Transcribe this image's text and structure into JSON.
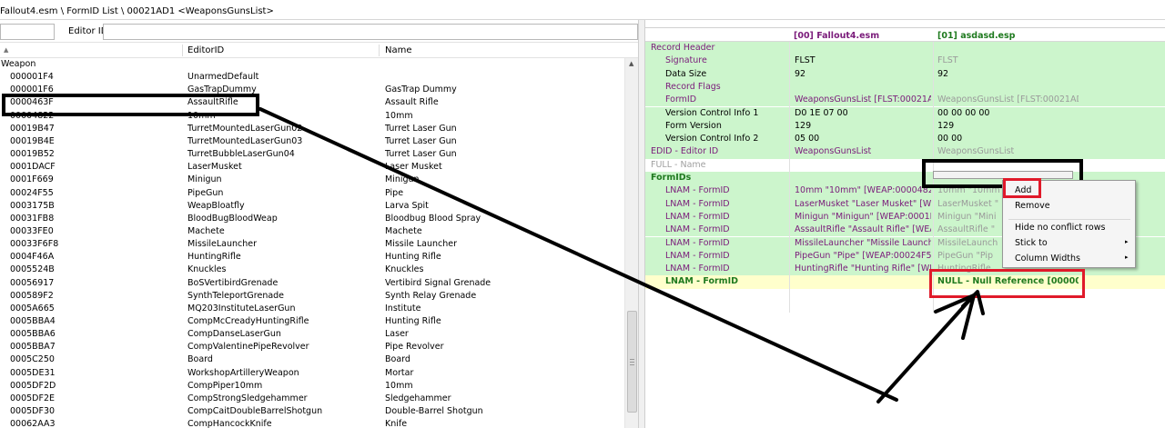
{
  "breadcrumb": "Fallout4.esm \\ FormID List \\ 00021AD1 <WeaponsGunsList>",
  "left": {
    "filter_label": "Editor ID",
    "columns": [
      "EditorID",
      "Name"
    ],
    "group": "Weapon",
    "rows": [
      {
        "formid": "000001F4",
        "editorid": "UnarmedDefault",
        "name": ""
      },
      {
        "formid": "000001F6",
        "editorid": "GasTrapDummy",
        "name": "GasTrap Dummy"
      },
      {
        "formid": "0000463F",
        "editorid": "AssaultRifle",
        "name": "Assault Rifle"
      },
      {
        "formid": "00004822",
        "editorid": "10mm",
        "name": "10mm"
      },
      {
        "formid": "00019B47",
        "editorid": "TurretMountedLaserGun02",
        "name": "Turret Laser Gun"
      },
      {
        "formid": "00019B4E",
        "editorid": "TurretMountedLaserGun03",
        "name": "Turret Laser Gun"
      },
      {
        "formid": "00019B52",
        "editorid": "TurretBubbleLaserGun04",
        "name": "Turret Laser Gun"
      },
      {
        "formid": "0001DACF",
        "editorid": "LaserMusket",
        "name": "Laser Musket"
      },
      {
        "formid": "0001F669",
        "editorid": "Minigun",
        "name": "Minigun"
      },
      {
        "formid": "00024F55",
        "editorid": "PipeGun",
        "name": "Pipe"
      },
      {
        "formid": "0003175B",
        "editorid": "WeapBloatfly",
        "name": "Larva Spit"
      },
      {
        "formid": "00031FB8",
        "editorid": "BloodBugBloodWeap",
        "name": "Bloodbug Blood Spray"
      },
      {
        "formid": "00033FE0",
        "editorid": "Machete",
        "name": "Machete"
      },
      {
        "formid": "00033F6F8",
        "editorid": "MissileLauncher",
        "name": "Missile Launcher"
      },
      {
        "formid": "0004F46A",
        "editorid": "HuntingRifle",
        "name": "Hunting Rifle"
      },
      {
        "formid": "0005524B",
        "editorid": "Knuckles",
        "name": "Knuckles"
      },
      {
        "formid": "00056917",
        "editorid": "BoSVertibirdGrenade",
        "name": "Vertibird Signal Grenade"
      },
      {
        "formid": "000589F2",
        "editorid": "SynthTeleportGrenade",
        "name": "Synth Relay Grenade"
      },
      {
        "formid": "0005A665",
        "editorid": "MQ203InstituteLaserGun",
        "name": "Institute"
      },
      {
        "formid": "0005BBA4",
        "editorid": "CompMcCreadyHuntingRifle",
        "name": "Hunting Rifle"
      },
      {
        "formid": "0005BBA6",
        "editorid": "CompDanseLaserGun",
        "name": "Laser"
      },
      {
        "formid": "0005BBA7",
        "editorid": "CompValentinePipeRevolver",
        "name": "Pipe Revolver"
      },
      {
        "formid": "0005C250",
        "editorid": "Board",
        "name": "Board"
      },
      {
        "formid": "0005DE31",
        "editorid": "WorkshopArtilleryWeapon",
        "name": "Mortar"
      },
      {
        "formid": "0005DF2D",
        "editorid": "CompPiper10mm",
        "name": "10mm"
      },
      {
        "formid": "0005DF2E",
        "editorid": "CompStrongSledgehammer",
        "name": "Sledgehammer"
      },
      {
        "formid": "0005DF30",
        "editorid": "CompCaitDoubleBarrelShotgun",
        "name": "Double-Barrel Shotgun"
      },
      {
        "formid": "00062AA3",
        "editorid": "CompHancockKnife",
        "name": "Knife"
      }
    ]
  },
  "right": {
    "col_master": "[00] Fallout4.esm",
    "col_plugin": "[01] asdasd.esp",
    "rows": [
      {
        "label": "Record Header",
        "indent": 0,
        "color": "#7a1b7a",
        "v1": "",
        "v2": "",
        "bg": "#ccf5cc"
      },
      {
        "label": "Signature",
        "indent": 1,
        "color": "#7a1b7a",
        "v1": "FLST",
        "v2": "FLST",
        "bg": "#ccf5cc",
        "v2grey": true
      },
      {
        "label": "Data Size",
        "indent": 1,
        "color": "#000000",
        "v1": "92",
        "v2": "92",
        "bg": "#ccf5cc"
      },
      {
        "label": "Record Flags",
        "indent": 1,
        "color": "#7a1b7a",
        "v1": "",
        "v2": "",
        "bg": "#ccf5cc"
      },
      {
        "label": "FormID",
        "indent": 1,
        "color": "#7a1b7a",
        "v1": "WeaponsGunsList [FLST:00021AD1]",
        "v2": "WeaponsGunsList [FLST:00021AD1]",
        "bg": "#ccf5cc",
        "v1purple": true,
        "v2grey": true
      },
      {
        "label": "Version Control Info 1",
        "indent": 1,
        "color": "#000000",
        "v1": "D0 1E 07 00",
        "v2": "00 00 00 00",
        "bg": "#ccf5cc"
      },
      {
        "label": "Form Version",
        "indent": 1,
        "color": "#000000",
        "v1": "129",
        "v2": "129",
        "bg": "#ccf5cc"
      },
      {
        "label": "Version Control Info 2",
        "indent": 1,
        "color": "#000000",
        "v1": "05 00",
        "v2": "00 00",
        "bg": "#ccf5cc"
      },
      {
        "label": "EDID - Editor ID",
        "indent": 0,
        "color": "#7a1b7a",
        "v1": "WeaponsGunsList",
        "v2": "WeaponsGunsList",
        "bg": "#ccf5cc",
        "v1purple": true,
        "v2grey": true
      },
      {
        "label": "FULL - Name",
        "indent": 0,
        "color": "#a0a0a0",
        "v1": "",
        "v2": "",
        "bg": "#ffffff"
      },
      {
        "label": "FormIDs",
        "indent": 0,
        "color": "#1f7a1f",
        "v1": "",
        "v2": "",
        "bg": "#ccf5cc",
        "bold": true
      },
      {
        "label": "LNAM - FormID",
        "indent": 1,
        "color": "#7a1b7a",
        "v1": "10mm \"10mm\" [WEAP:00004822]",
        "v2": "10mm \"10mm\"",
        "bg": "#ccf5cc",
        "v1purple": true,
        "v2grey": true
      },
      {
        "label": "LNAM - FormID",
        "indent": 1,
        "color": "#7a1b7a",
        "v1": "LaserMusket \"Laser Musket\" [WE...",
        "v2": "LaserMusket \"",
        "bg": "#ccf5cc",
        "v1purple": true,
        "v2grey": true
      },
      {
        "label": "LNAM - FormID",
        "indent": 1,
        "color": "#7a1b7a",
        "v1": "Minigun \"Minigun\" [WEAP:0001F...",
        "v2": "Minigun \"Mini",
        "bg": "#ccf5cc",
        "v1purple": true,
        "v2grey": true
      },
      {
        "label": "LNAM - FormID",
        "indent": 1,
        "color": "#7a1b7a",
        "v1": "AssaultRifle \"Assault Rifle\" [WEAP...",
        "v2": "AssaultRifle \"",
        "bg": "#ccf5cc",
        "v1purple": true,
        "v2grey": true
      },
      {
        "label": "LNAM - FormID",
        "indent": 1,
        "color": "#7a1b7a",
        "v1": "MissileLauncher \"Missile Launche...",
        "v2": "MissileLaunch",
        "bg": "#ccf5cc",
        "v1purple": true,
        "v2grey": true
      },
      {
        "label": "LNAM - FormID",
        "indent": 1,
        "color": "#7a1b7a",
        "v1": "PipeGun \"Pipe\" [WEAP:00024F55]",
        "v2": "PipeGun \"Pip",
        "bg": "#ccf5cc",
        "v1purple": true,
        "v2grey": true
      },
      {
        "label": "LNAM - FormID",
        "indent": 1,
        "color": "#7a1b7a",
        "v1": "HuntingRifle \"Hunting Rifle\" [WE...",
        "v2": "HuntingRifle",
        "bg": "#ccf5cc",
        "v1purple": true,
        "v2grey": true
      },
      {
        "label": "LNAM - FormID",
        "indent": 1,
        "color": "#1f7a1f",
        "v1": "",
        "v2": "NULL - Null Reference [000000...",
        "bg": "#ffffcc",
        "bold": true,
        "v2green": true
      }
    ]
  },
  "context_menu": {
    "items": [
      "Add",
      "Remove",
      "Hide no conflict rows",
      "Stick to",
      "Column Widths"
    ],
    "submenu_arrow": "▸"
  },
  "colors": {
    "green_bg": "#ccf5cc",
    "yellow_bg": "#ffffcc",
    "purple_text": "#7a1b7a",
    "green_text": "#1f7a1f",
    "annotation_red": "#e01a2a"
  }
}
